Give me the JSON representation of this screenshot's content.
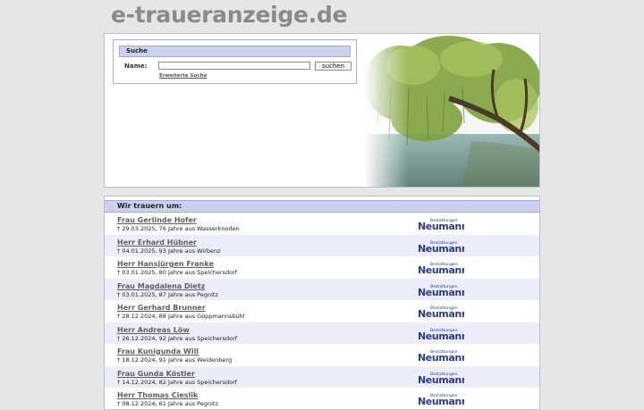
{
  "site": {
    "logo": "e-traueranzeige.de"
  },
  "search": {
    "title": "Suche",
    "name_label": "Name:",
    "name_value": "",
    "button_label": "suchen",
    "advanced_link": "Erweiterte Suche"
  },
  "list": {
    "title": "Wir trauern um:",
    "entries": [
      {
        "name": "Frau Gerlinde Hofer",
        "details": "† 29.03.2025, 76 Jahre aus Wasserknoden"
      },
      {
        "name": "Herr Erhard Hübner",
        "details": "† 04.01.2025, 93 Jahre aus Wirbenz"
      },
      {
        "name": "Herr Hansjürgen Franke",
        "details": "† 03.01.2025, 80 Jahre aus Speichersdorf"
      },
      {
        "name": "Frau Magdalena Dietz",
        "details": "† 03.01.2025, 87 Jahre aus Pegnitz"
      },
      {
        "name": "Herr Gerhard Brunner",
        "details": "† 28.12.2024, 88 Jahre aus Göppmannsbühl"
      },
      {
        "name": "Herr Andreas Löw",
        "details": "† 26.12.2024, 92 Jahre aus Speichersdorf"
      },
      {
        "name": "Frau Kunigunda Will",
        "details": "† 18.12.2024, 91 Jahre aus Weidenberg"
      },
      {
        "name": "Frau Gunda Köstler",
        "details": "† 14.12.2024, 82 Jahre aus Speichersdorf"
      },
      {
        "name": "Herr Thomas Cieslik",
        "details": "† 08.12.2024, 61 Jahre aus Pegnitz"
      }
    ]
  },
  "sponsor": {
    "small": "Bestattungen",
    "big": "Neumann",
    "color": "#2a3b8f"
  },
  "colors": {
    "header_band": "#ccd1f0",
    "alt_row": "#ebedfa",
    "border": "#b9bfd6"
  }
}
